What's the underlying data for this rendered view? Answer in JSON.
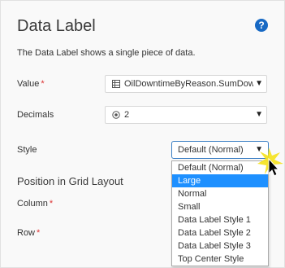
{
  "panel": {
    "title": "Data Label",
    "help_glyph": "?",
    "description": "The Data Label shows a single piece of data."
  },
  "value": {
    "label": "Value",
    "required_mark": "*",
    "icon": "table-icon",
    "text": "OilDowntimeByReason.SumDowntime"
  },
  "decimals": {
    "label": "Decimals",
    "icon": "radio-dot-icon",
    "text": "2"
  },
  "style": {
    "label": "Style",
    "selected": "Default (Normal)",
    "options": [
      "Default (Normal)",
      "Large",
      "Normal",
      "Small",
      "Data Label Style 1",
      "Data Label Style 2",
      "Data Label Style 3",
      "Top Center Style"
    ],
    "highlighted_index": 1
  },
  "grid": {
    "heading": "Position in Grid Layout",
    "column_label": "Column",
    "row_label": "Row",
    "required_mark": "*"
  },
  "colors": {
    "accent": "#1769c4",
    "highlight": "#1e90ff",
    "required": "#dd3333"
  }
}
